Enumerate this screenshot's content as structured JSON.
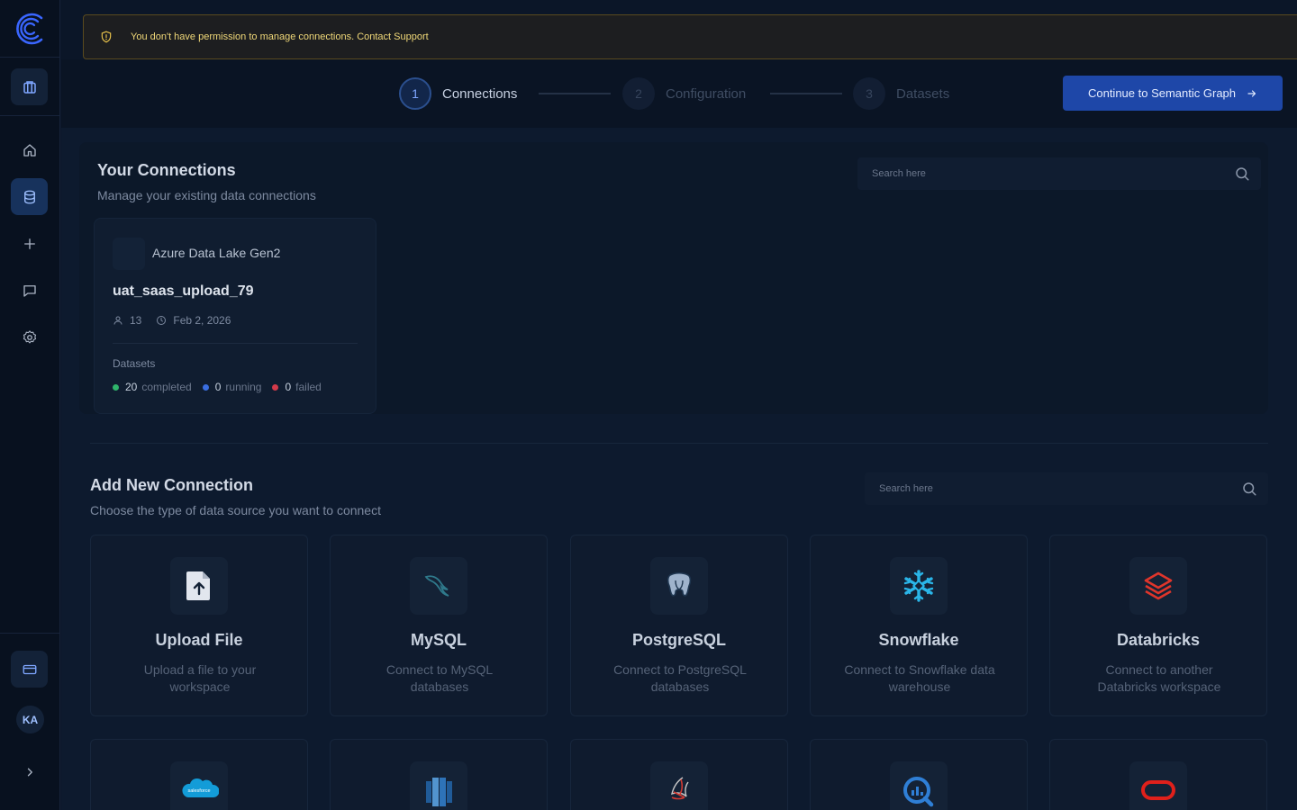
{
  "alert": {
    "message": "You don't have permission to manage connections. Contact Support"
  },
  "user": {
    "initials": "KA"
  },
  "stepper": {
    "steps": [
      {
        "number": "1",
        "label": "Connections",
        "state": "active"
      },
      {
        "number": "2",
        "label": "Configuration",
        "state": "inactive"
      },
      {
        "number": "3",
        "label": "Datasets",
        "state": "inactive"
      }
    ],
    "continue_label": "Continue to Semantic Graph"
  },
  "your_connections": {
    "title": "Your Connections",
    "subtitle": "Manage your existing data connections",
    "search_placeholder": "Search here",
    "cards": [
      {
        "type": "Azure Data Lake Gen2",
        "name": "uat_saas_upload_79",
        "users": "13",
        "date": "Feb 2, 2026",
        "datasets_label": "Datasets",
        "completed": "20",
        "completed_label": "completed",
        "running": "0",
        "running_label": "running",
        "failed": "0",
        "failed_label": "failed"
      }
    ]
  },
  "add_connection": {
    "title": "Add New Connection",
    "subtitle": "Choose the type of data source you want to connect",
    "search_placeholder": "Search here",
    "sources": [
      {
        "title": "Upload File",
        "description": "Upload a file to your workspace",
        "icon": "upload-file-icon"
      },
      {
        "title": "MySQL",
        "description": "Connect to MySQL databases",
        "icon": "mysql-icon"
      },
      {
        "title": "PostgreSQL",
        "description": "Connect to PostgreSQL databases",
        "icon": "postgresql-icon"
      },
      {
        "title": "Snowflake",
        "description": "Connect to Snowflake data warehouse",
        "icon": "snowflake-icon"
      },
      {
        "title": "Databricks",
        "description": "Connect to another Databricks workspace",
        "icon": "databricks-icon"
      }
    ],
    "more_sources": [
      {
        "icon": "salesforce-icon",
        "logo_text": "salesforce"
      },
      {
        "icon": "redshift-icon"
      },
      {
        "icon": "sql-server-icon"
      },
      {
        "icon": "qlik-icon"
      },
      {
        "icon": "oracle-icon"
      }
    ]
  },
  "colors": {
    "accent": "#1e47a8",
    "warning": "#f0d878",
    "completed": "#2fb46b",
    "running": "#3a6ee0",
    "failed": "#d33a4a"
  }
}
